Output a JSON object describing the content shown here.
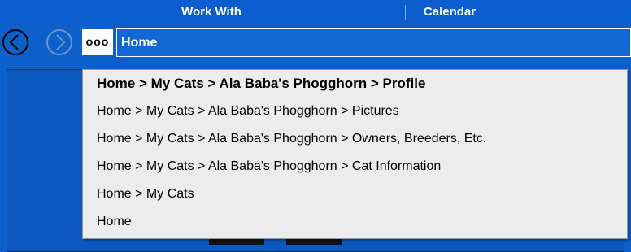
{
  "menubar": {
    "items": [
      {
        "label": "Work With"
      },
      {
        "label": "Calendar"
      }
    ]
  },
  "nav": {
    "more_label": "ooo",
    "address": "Home"
  },
  "breadcrumb_history": [
    {
      "label": "Home > My Cats > Ala Baba's Phogghorn > Profile",
      "current": true
    },
    {
      "label": "Home > My Cats > Ala Baba's Phogghorn > Pictures",
      "current": false
    },
    {
      "label": "Home > My Cats > Ala Baba's Phogghorn > Owners, Breeders, Etc.",
      "current": false
    },
    {
      "label": "Home > My Cats > Ala Baba's Phogghorn > Cat Information",
      "current": false
    },
    {
      "label": "Home > My Cats",
      "current": false
    },
    {
      "label": "Home",
      "current": false
    }
  ],
  "colors": {
    "app_background": "#0d5fc9",
    "menu_background": "#0a5ccf",
    "dropdown_background": "#ececec"
  }
}
